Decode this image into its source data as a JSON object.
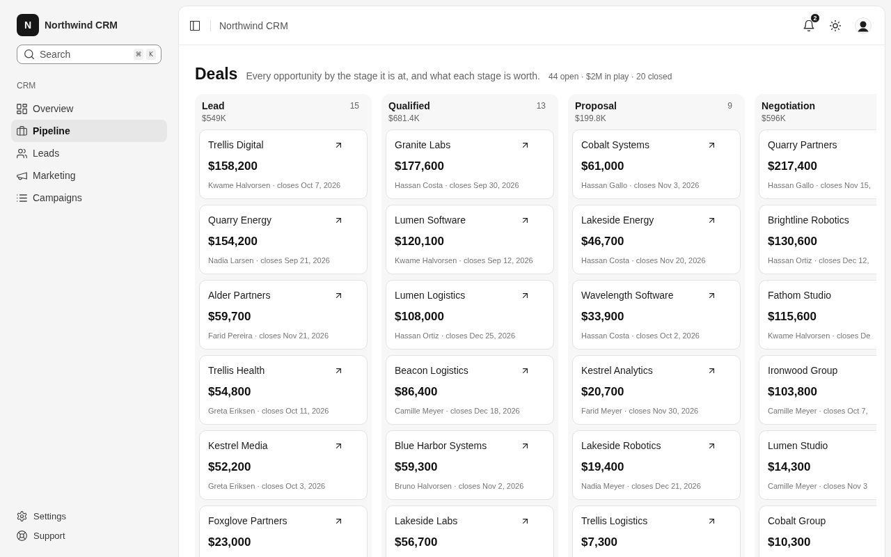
{
  "sidebar": {
    "brand": {
      "logo": "N",
      "name": "Northwind CRM"
    },
    "search": {
      "placeholder": "Search",
      "shortcut": [
        "⌘",
        "K"
      ]
    },
    "section": "CRM",
    "items": [
      {
        "label": "Overview",
        "selected": false
      },
      {
        "label": "Pipeline",
        "selected": true
      },
      {
        "label": "Leads",
        "selected": false
      },
      {
        "label": "Marketing",
        "selected": false
      },
      {
        "label": "Campaigns",
        "selected": false
      }
    ],
    "footer_items": [
      {
        "label": "Settings"
      },
      {
        "label": "Support"
      }
    ]
  },
  "header": {
    "breadcrumb": "Northwind CRM",
    "notification_count": "2"
  },
  "page": {
    "title": "Deals",
    "subtitle": "Every opportunity by the stage it is at, and what each stage is worth.",
    "summary": "44 open · $2M in play · 20 closed"
  },
  "board": {
    "columns": [
      {
        "name": "Lead",
        "count": "15",
        "total": "$549K",
        "cut_off": false,
        "cards": [
          {
            "company": "Trellis Digital",
            "amount": "$158,200",
            "meta": "Kwame Halvorsen · closes Oct 7, 2026"
          },
          {
            "company": "Quarry Energy",
            "amount": "$154,200",
            "meta": "Nadia Larsen · closes Sep 21, 2026"
          },
          {
            "company": "Alder Partners",
            "amount": "$59,700",
            "meta": "Farid Pereira · closes Nov 21, 2026"
          },
          {
            "company": "Trellis Health",
            "amount": "$54,800",
            "meta": "Greta Eriksen · closes Oct 11, 2026"
          },
          {
            "company": "Kestrel Media",
            "amount": "$52,200",
            "meta": "Greta Eriksen · closes Oct 3, 2026"
          },
          {
            "company": "Foxglove Partners",
            "amount": "$23,000"
          }
        ]
      },
      {
        "name": "Qualified",
        "count": "13",
        "total": "$681.4K",
        "cut_off": false,
        "cards": [
          {
            "company": "Granite Labs",
            "amount": "$177,600",
            "meta": "Hassan Costa · closes Sep 30, 2026"
          },
          {
            "company": "Lumen Software",
            "amount": "$120,100",
            "meta": "Kwame Halvorsen · closes Sep 12, 2026"
          },
          {
            "company": "Lumen Logistics",
            "amount": "$108,000",
            "meta": "Hassan Ortiz · closes Dec 25, 2026"
          },
          {
            "company": "Beacon Logistics",
            "amount": "$86,400",
            "meta": "Camille Meyer · closes Dec 18, 2026"
          },
          {
            "company": "Blue Harbor Systems",
            "amount": "$59,300",
            "meta": "Bruno Halvorsen · closes Nov 2, 2026"
          },
          {
            "company": "Lakeside Labs",
            "amount": "$56,700"
          }
        ]
      },
      {
        "name": "Proposal",
        "count": "9",
        "total": "$199.8K",
        "cut_off": false,
        "cards": [
          {
            "company": "Cobalt Systems",
            "amount": "$61,000",
            "meta": "Hassan Gallo · closes Nov 3, 2026"
          },
          {
            "company": "Lakeside Energy",
            "amount": "$46,700",
            "meta": "Hassan Costa · closes Nov 20, 2026"
          },
          {
            "company": "Wavelength Software",
            "amount": "$33,900",
            "meta": "Hassan Costa · closes Oct 2, 2026"
          },
          {
            "company": "Kestrel Analytics",
            "amount": "$20,700",
            "meta": "Farid Meyer · closes Nov 30, 2026"
          },
          {
            "company": "Lakeside Robotics",
            "amount": "$19,400",
            "meta": "Nadia Meyer · closes Dec 21, 2026"
          },
          {
            "company": "Trellis Logistics",
            "amount": "$7,300"
          }
        ]
      },
      {
        "name": "Negotiation",
        "total": "$596K",
        "cut_off": true,
        "cards": [
          {
            "company": "Quarry Partners",
            "amount": "$217,400",
            "meta": "Hassan Gallo · closes Nov 15,"
          },
          {
            "company": "Brightline Robotics",
            "amount": "$130,600",
            "meta": "Hassan Ortiz · closes Dec 12,"
          },
          {
            "company": "Fathom Studio",
            "amount": "$115,600",
            "meta": "Kwame Halvorsen · closes De"
          },
          {
            "company": "Ironwood Group",
            "amount": "$103,800",
            "meta": "Camille Meyer · closes Oct 7,"
          },
          {
            "company": "Lumen Studio",
            "amount": "$14,300",
            "meta": "Camille Meyer · closes Nov 3"
          },
          {
            "company": "Cobalt Group",
            "amount": "$10,300"
          }
        ]
      }
    ]
  }
}
